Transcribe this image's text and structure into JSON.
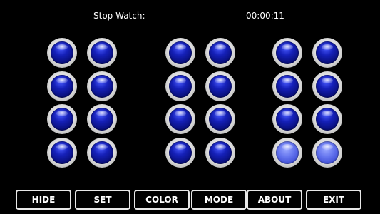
{
  "header": {
    "label": "Stop Watch:",
    "time": "00:00:11"
  },
  "clock": {
    "lit_color": "#6676ef",
    "unlit_color": "#0b128a",
    "columns": [
      {
        "name": "hours-tens",
        "lit": [
          false,
          false,
          false,
          false
        ]
      },
      {
        "name": "hours-ones",
        "lit": [
          false,
          false,
          false,
          false
        ]
      },
      {
        "name": "minutes-tens",
        "lit": [
          false,
          false,
          false,
          false
        ]
      },
      {
        "name": "minutes-ones",
        "lit": [
          false,
          false,
          false,
          false
        ]
      },
      {
        "name": "seconds-tens",
        "lit": [
          false,
          false,
          false,
          true
        ]
      },
      {
        "name": "seconds-ones",
        "lit": [
          false,
          false,
          false,
          true
        ]
      }
    ]
  },
  "buttons": [
    {
      "id": "hide",
      "label": "HIDE"
    },
    {
      "id": "set",
      "label": "SET"
    },
    {
      "id": "color",
      "label": "COLOR"
    },
    {
      "id": "mode",
      "label": "MODE"
    },
    {
      "id": "about",
      "label": "ABOUT"
    },
    {
      "id": "exit",
      "label": "EXIT"
    }
  ]
}
